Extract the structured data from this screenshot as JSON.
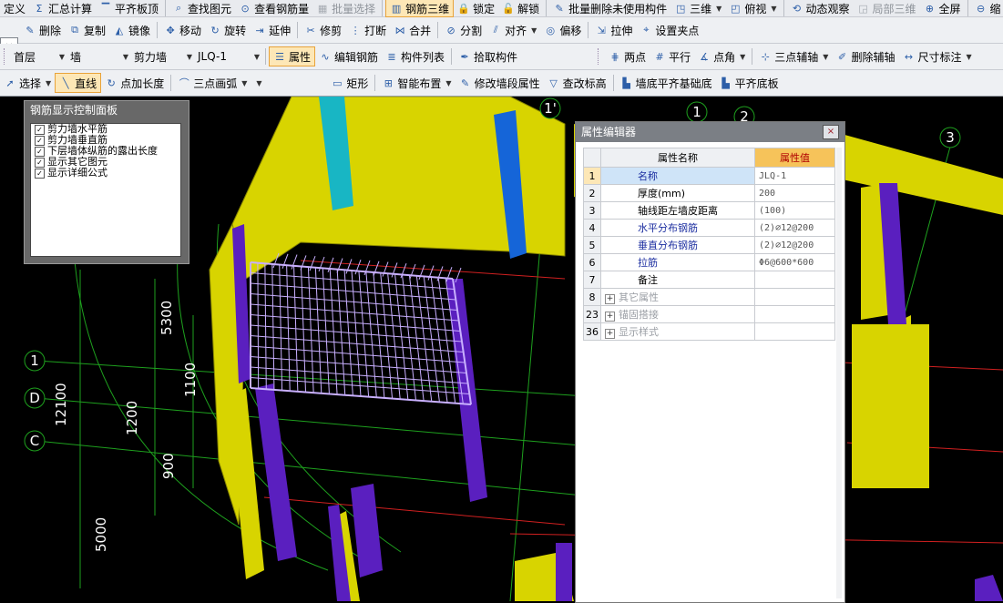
{
  "toolbar1": {
    "items": [
      {
        "label": "定义",
        "icon": ""
      },
      {
        "label": "汇总计算",
        "icon": "sigma-icon"
      },
      {
        "label": "平齐板顶",
        "icon": "align-top-icon"
      },
      {
        "label": "查找图元",
        "icon": "find-element-icon"
      },
      {
        "label": "查看钢筋量",
        "icon": "view-rebar-icon"
      },
      {
        "label": "批量选择",
        "icon": "batch-select-icon",
        "disabled": true
      },
      {
        "label": "钢筋三维",
        "icon": "rebar-3d-icon",
        "active": true
      },
      {
        "label": "锁定",
        "icon": "lock-icon"
      },
      {
        "label": "解锁",
        "icon": "unlock-icon"
      },
      {
        "label": "批量删除未使用构件",
        "icon": "batch-delete-icon"
      },
      {
        "label": "三维",
        "icon": "3d-view-icon",
        "dropdown": true
      },
      {
        "label": "俯视",
        "icon": "top-view-icon",
        "dropdown": true
      },
      {
        "label": "动态观察",
        "icon": "orbit-icon"
      },
      {
        "label": "局部三维",
        "icon": "local-3d-icon",
        "disabled": true
      },
      {
        "label": "全屏",
        "icon": "fullscreen-icon"
      },
      {
        "label": "缩",
        "icon": "zoom-icon"
      }
    ]
  },
  "toolbar2": {
    "close_glyph": "×",
    "items": [
      {
        "label": "删除",
        "icon": "delete-icon"
      },
      {
        "label": "复制",
        "icon": "copy-icon"
      },
      {
        "label": "镜像",
        "icon": "mirror-icon"
      },
      {
        "label": "移动",
        "icon": "move-icon"
      },
      {
        "label": "旋转",
        "icon": "rotate-icon"
      },
      {
        "label": "延伸",
        "icon": "extend-icon"
      },
      {
        "label": "修剪",
        "icon": "trim-icon"
      },
      {
        "label": "打断",
        "icon": "break-icon"
      },
      {
        "label": "合并",
        "icon": "merge-icon"
      },
      {
        "label": "分割",
        "icon": "split-icon"
      },
      {
        "label": "对齐",
        "icon": "align-icon",
        "dropdown": true
      },
      {
        "label": "偏移",
        "icon": "offset-icon"
      },
      {
        "label": "拉伸",
        "icon": "stretch-icon"
      },
      {
        "label": "设置夹点",
        "icon": "grip-point-icon"
      }
    ]
  },
  "toolbar3": {
    "floor": "首层",
    "category": "墙",
    "type": "剪力墙",
    "component": "JLQ-1",
    "items": [
      {
        "label": "属性",
        "icon": "properties-icon",
        "active": true
      },
      {
        "label": "编辑钢筋",
        "icon": "edit-rebar-icon"
      },
      {
        "label": "构件列表",
        "icon": "component-list-icon"
      },
      {
        "label": "拾取构件",
        "icon": "pick-component-icon"
      }
    ],
    "right_items": [
      {
        "label": "两点",
        "icon": "two-point-axis-icon"
      },
      {
        "label": "平行",
        "icon": "parallel-axis-icon"
      },
      {
        "label": "点角",
        "icon": "point-angle-icon",
        "dropdown": true
      },
      {
        "label": "三点辅轴",
        "icon": "three-point-axis-icon",
        "dropdown": true
      },
      {
        "label": "删除辅轴",
        "icon": "delete-axis-icon"
      },
      {
        "label": "尺寸标注",
        "icon": "dimension-icon",
        "dropdown": true
      }
    ]
  },
  "toolbar4": {
    "items": [
      {
        "label": "选择",
        "icon": "cursor-icon",
        "dropdown": true
      },
      {
        "label": "直线",
        "icon": "line-icon",
        "active": true
      },
      {
        "label": "点加长度",
        "icon": "point-length-icon"
      },
      {
        "label": "三点画弧",
        "icon": "arc-icon",
        "dropdown": true
      },
      {
        "label": "",
        "icon": "",
        "dropdown": true
      },
      {
        "label": "矩形",
        "icon": "rectangle-icon"
      },
      {
        "label": "智能布置",
        "icon": "smart-layout-icon",
        "dropdown": true
      },
      {
        "label": "修改墙段属性",
        "icon": "modify-wall-icon"
      },
      {
        "label": "查改标高",
        "icon": "elevation-icon"
      },
      {
        "label": "墙底平齐基础底",
        "icon": "wall-base-align-icon"
      },
      {
        "label": "平齐底板",
        "icon": "align-slab-icon"
      }
    ]
  },
  "rebar_panel": {
    "title": "钢筋显示控制面板",
    "options": [
      {
        "label": "剪力墙水平筋",
        "checked": true
      },
      {
        "label": "剪力墙垂直筋",
        "checked": true
      },
      {
        "label": "下层墙体纵筋的露出长度",
        "checked": true
      },
      {
        "label": "显示其它图元",
        "checked": true
      },
      {
        "label": "显示详细公式",
        "checked": true
      }
    ]
  },
  "viewport": {
    "axis_labels": [
      "1'",
      "1",
      "2",
      "3",
      "1",
      "D",
      "C"
    ],
    "dimensions": [
      "5300",
      "1100",
      "12100",
      "1200",
      "900",
      "5000"
    ],
    "colors": {
      "wall": "#d8d400",
      "column": "#5a1fbf",
      "axis": "#1ea01e",
      "rebar": "#c9b0ff",
      "cyan": "#18b6c4",
      "blue": "#1565d8"
    }
  },
  "property_editor": {
    "title": "属性编辑器",
    "close_glyph": "×",
    "col_name": "属性名称",
    "col_value": "属性值",
    "rows": [
      {
        "num": "1",
        "name": "名称",
        "value": "JLQ-1",
        "style": "blue",
        "selected": true
      },
      {
        "num": "2",
        "name": "厚度(mm)",
        "value": "200",
        "style": "normal"
      },
      {
        "num": "3",
        "name": "轴线距左墙皮距离",
        "value": "(100)",
        "style": "normal"
      },
      {
        "num": "4",
        "name": "水平分布钢筋",
        "value": "(2)⌀12@200",
        "style": "blue"
      },
      {
        "num": "5",
        "name": "垂直分布钢筋",
        "value": "(2)⌀12@200",
        "style": "blue"
      },
      {
        "num": "6",
        "name": "拉筋",
        "value": "Φ6@600*600",
        "style": "blue"
      },
      {
        "num": "7",
        "name": "备注",
        "value": "",
        "style": "normal"
      },
      {
        "num": "8",
        "name": "其它属性",
        "value": "",
        "style": "grey",
        "expand": "+"
      },
      {
        "num": "23",
        "name": "锚固搭接",
        "value": "",
        "style": "grey",
        "expand": "+"
      },
      {
        "num": "36",
        "name": "显示样式",
        "value": "",
        "style": "grey",
        "expand": "+"
      }
    ]
  }
}
